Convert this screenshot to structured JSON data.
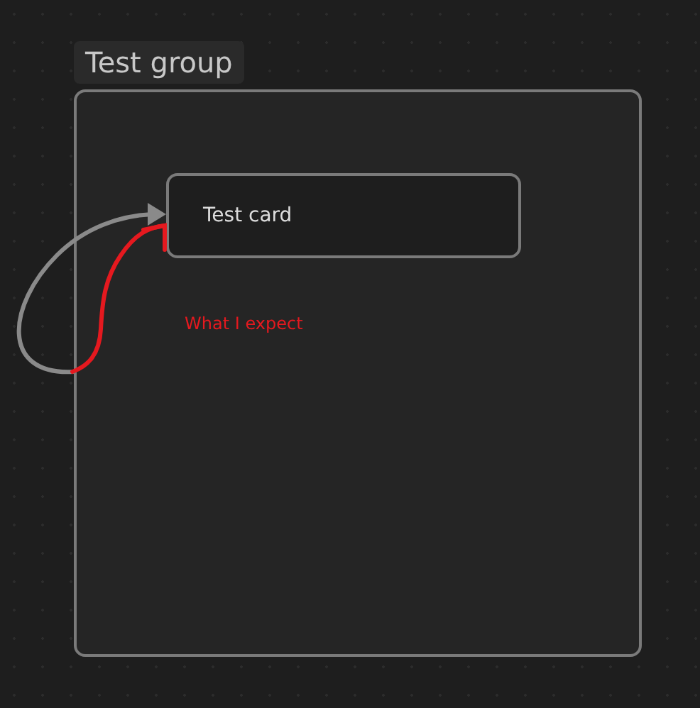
{
  "canvas": {
    "group": {
      "label": "Test group"
    },
    "card": {
      "text": "Test card"
    },
    "annotation": {
      "text": "What I expect"
    }
  }
}
